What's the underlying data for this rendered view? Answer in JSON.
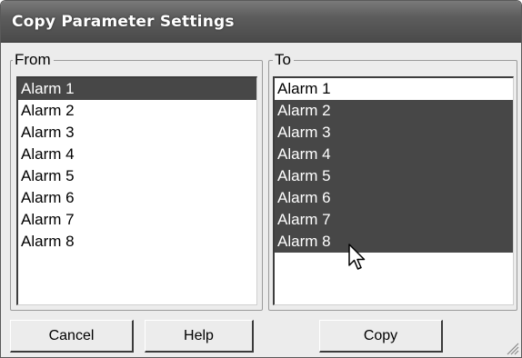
{
  "window": {
    "title": "Copy Parameter Settings"
  },
  "from_group": {
    "legend": "From",
    "items": [
      {
        "label": "Alarm 1",
        "selected": true
      },
      {
        "label": "Alarm 2",
        "selected": false
      },
      {
        "label": "Alarm 3",
        "selected": false
      },
      {
        "label": "Alarm 4",
        "selected": false
      },
      {
        "label": "Alarm 5",
        "selected": false
      },
      {
        "label": "Alarm 6",
        "selected": false
      },
      {
        "label": "Alarm 7",
        "selected": false
      },
      {
        "label": "Alarm 8",
        "selected": false
      }
    ]
  },
  "to_group": {
    "legend": "To",
    "items": [
      {
        "label": "Alarm 1",
        "selected": false
      },
      {
        "label": "Alarm 2",
        "selected": true
      },
      {
        "label": "Alarm 3",
        "selected": true
      },
      {
        "label": "Alarm 4",
        "selected": true
      },
      {
        "label": "Alarm 5",
        "selected": true
      },
      {
        "label": "Alarm 6",
        "selected": true
      },
      {
        "label": "Alarm 7",
        "selected": true
      },
      {
        "label": "Alarm 8",
        "selected": true
      }
    ]
  },
  "buttons": {
    "cancel_label": "Cancel",
    "help_label": "Help",
    "copy_label": "Copy"
  },
  "colors": {
    "title_bar": "#5c5c5c",
    "selection": "#474747",
    "dialog_background": "#ececec"
  },
  "icons": {
    "cursor": "mouse-pointer-icon",
    "grip": "resize-grip-icon"
  }
}
